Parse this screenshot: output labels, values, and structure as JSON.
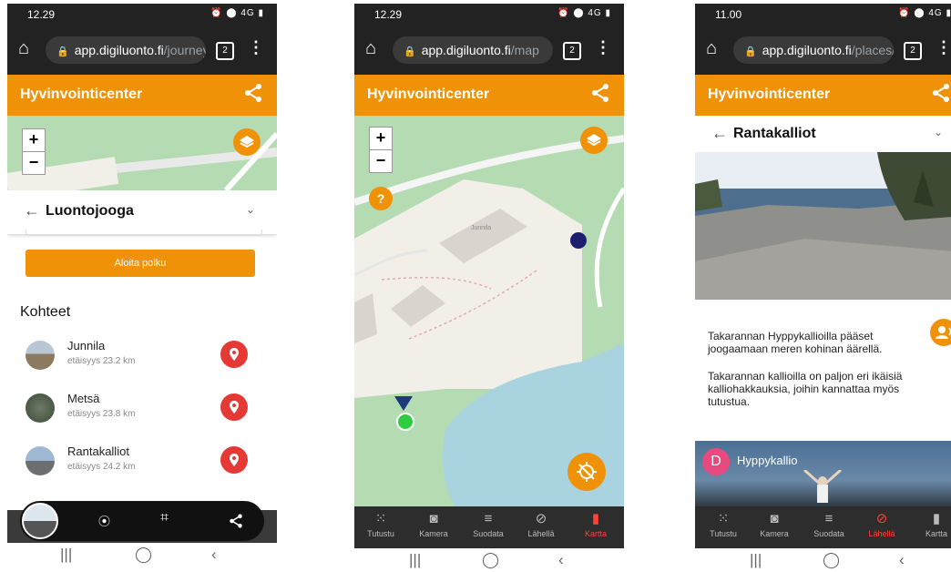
{
  "browser": {
    "tab_count": "2",
    "url_host": "app.digiluonto.fi",
    "phone1_url_path": "/journey",
    "phone2_url_path": "/map",
    "phone3_url_path": "/places/"
  },
  "status": {
    "phone1_time": "12.29",
    "phone2_time": "12.29",
    "phone3_time": "11.00",
    "icons": "⏰ ⬤ 4G ▮"
  },
  "app": {
    "title": "Hyvinvointicenter"
  },
  "phone1": {
    "panel_title": "Luontojooga",
    "start_button": "Aloita polku",
    "section_title": "Kohteet",
    "places": [
      {
        "name": "Junnila",
        "distance": "etäisyys 23.2 km"
      },
      {
        "name": "Metsä",
        "distance": "etäisyys 23.8 km"
      },
      {
        "name": "Rantakalliot",
        "distance": "etäisyys 24.2 km"
      }
    ],
    "zoom_in": "+",
    "zoom_out": "−"
  },
  "phone2": {
    "building_label": "Junnila",
    "zoom_in": "+",
    "zoom_out": "−",
    "help": "?"
  },
  "phone3": {
    "place_title": "Rantakalliot",
    "paragraph1": "Takarannan Hyppykallioilla pääset joogaamaan meren kohinan äärellä.",
    "paragraph2": "Takarannan kallioilla on paljon eri ikäisiä kalliohakkauksia, joihin kannattaa myös tutustua.",
    "video_avatar": "D",
    "video_title": "Hyppykallio"
  },
  "nav": {
    "items": [
      "Tutustu",
      "Kamera",
      "Suodata",
      "Lähellä",
      "Kartta"
    ]
  },
  "colors": {
    "brand": "#ef9208",
    "map_green": "#b5dbb2",
    "water": "#a9d3df",
    "marker_red": "#e53935",
    "active_nav": "#ff4136"
  }
}
